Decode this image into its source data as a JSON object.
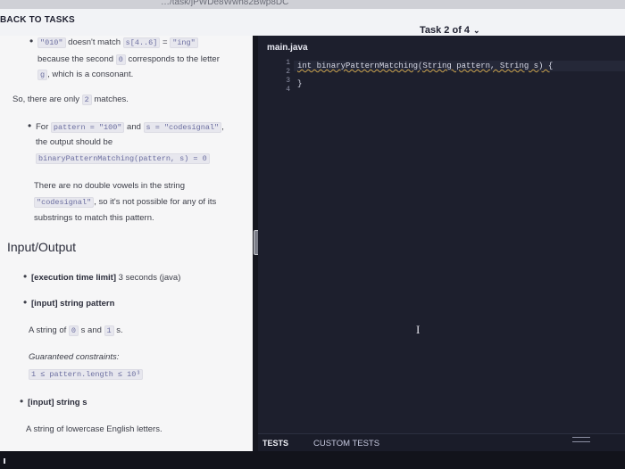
{
  "url_fragment": "…/task/jPWDe8Wwh82Bwp8DC",
  "header": {
    "back_label": "BACK TO TASKS",
    "task_counter": "Task 2 of 4",
    "chevron": "⌄"
  },
  "description": {
    "line1_code_a": "\"010\"",
    "line1_text": "doesn't match",
    "line1_code_b": "s[4..6]",
    "line1_eq": "=",
    "line1_code_c": "\"ing\"",
    "line2_text": "because the second",
    "line2_code": "0",
    "line2_tail": "corresponds to the letter",
    "line3_code": "g",
    "line3_text": ", which is a consonant.",
    "so_line": "So, there are only",
    "so_code": "2",
    "so_tail": "matches.",
    "for_text": "For",
    "for_code_a": "pattern = \"100\"",
    "for_and": "and",
    "for_code_b": "s = \"codesignal\"",
    "for_comma": ",",
    "output_line": "the output should be",
    "output_code": "binaryPatternMatching(pattern, s) = 0",
    "no_double": "There are no double vowels in the string",
    "codesignal_code": "\"codesignal\"",
    "codesignal_tail": ", so it's not possible for any of its",
    "substrings": "substrings to match this pattern.",
    "io_title": "Input/Output",
    "exec_limit_label": "[execution time limit]",
    "exec_limit_value": "3 seconds (java)",
    "input_pattern_label": "[input] string pattern",
    "string_of": "A string of",
    "string_of_code_a": "0",
    "s_and": "s and",
    "string_of_code_b": "1",
    "s_dot": "s.",
    "guaranteed": "Guaranteed constraints:",
    "constraint": "1 ≤ pattern.length ≤ 10³",
    "input_s_label": "[input] string s",
    "lowercase": "A string of lowercase English letters."
  },
  "editor": {
    "file_name": "main.java",
    "line_numbers": [
      "1",
      "2",
      "3",
      "4"
    ],
    "code_line1": "int binaryPatternMatching(String pattern, String s) {",
    "code_line3": "}"
  },
  "tests": {
    "tests_label": "TESTS",
    "custom_label": "CUSTOM TESTS"
  }
}
